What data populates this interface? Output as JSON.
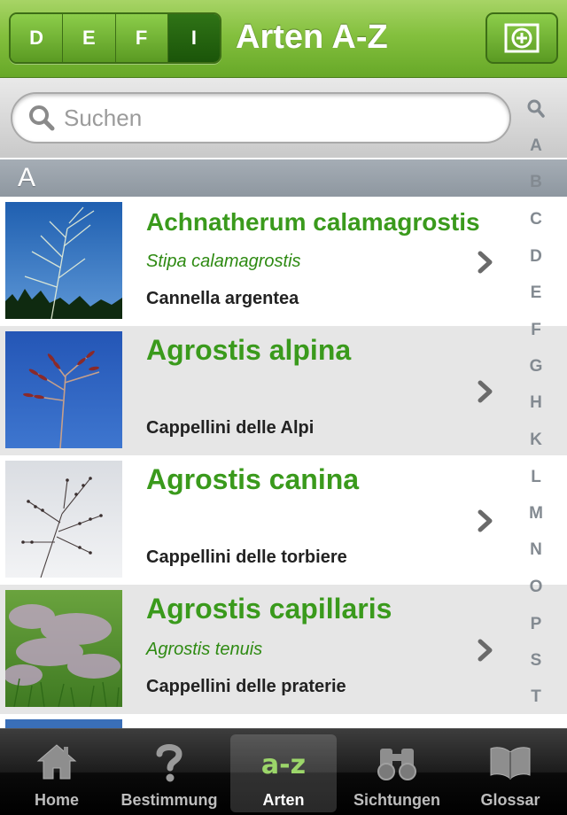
{
  "header": {
    "title": "Arten A-Z",
    "languages": [
      "D",
      "E",
      "F",
      "I"
    ],
    "active_language": "I",
    "add_button_icon": "plus-circle-icon"
  },
  "search": {
    "placeholder": "Suchen",
    "value": ""
  },
  "section": {
    "letter": "A"
  },
  "species": [
    {
      "scientific": "Achnatherum calamagrostis",
      "synonym": "Stipa calamagrostis",
      "common": "Cannella argentea"
    },
    {
      "scientific": "Agrostis alpina",
      "synonym": "",
      "common": "Cappellini delle Alpi"
    },
    {
      "scientific": "Agrostis canina",
      "synonym": "",
      "common": "Cappellini delle torbiere"
    },
    {
      "scientific": "Agrostis capillaris",
      "synonym": "Agrostis tenuis",
      "common": "Cappellini delle praterie"
    }
  ],
  "alphabet_index": [
    "A",
    "B",
    "C",
    "D",
    "E",
    "F",
    "G",
    "H",
    "K",
    "L",
    "M",
    "N",
    "O",
    "P",
    "S",
    "T"
  ],
  "tabs": [
    {
      "label": "Home",
      "icon": "home-icon"
    },
    {
      "label": "Bestimmung",
      "icon": "question-mark-icon"
    },
    {
      "label": "Arten",
      "icon": "a-z-icon",
      "icon_text": "a-z",
      "active": true
    },
    {
      "label": "Sichtungen",
      "icon": "binoculars-icon"
    },
    {
      "label": "Glossar",
      "icon": "open-book-icon"
    }
  ],
  "colors": {
    "header_green": "#84c03e",
    "species_green": "#3a9a1c",
    "active_segment": "#2f7316"
  }
}
